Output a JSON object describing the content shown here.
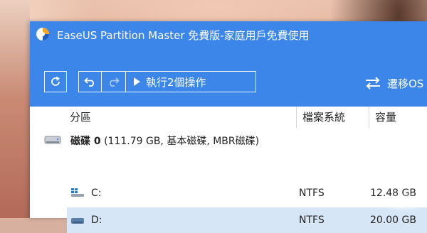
{
  "window": {
    "title": "EaseUS Partition Master 免費版-家庭用戶免費使用"
  },
  "toolbar": {
    "apply_label": "執行2個操作",
    "migrate_label": "遷移OS"
  },
  "table": {
    "headers": {
      "partition": "分區",
      "filesystem": "檔案系統",
      "capacity": "容量"
    }
  },
  "disk": {
    "name": "磁碟 0",
    "details": "(111.79 GB, 基本磁碟, MBR磁碟)"
  },
  "partitions": [
    {
      "name": "C:",
      "filesystem": "NTFS",
      "capacity": "12.48 GB"
    },
    {
      "name": "D:",
      "filesystem": "NTFS",
      "capacity": "20.00 GB"
    }
  ],
  "colors": {
    "accent": "#3b86e8",
    "selection": "#d6e6f7"
  }
}
